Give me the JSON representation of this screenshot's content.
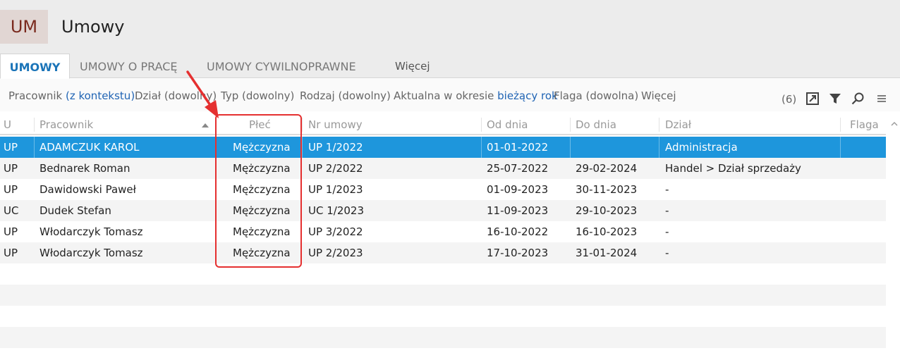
{
  "app": {
    "logo": "UM",
    "title": "Umowy"
  },
  "tabs": [
    {
      "label": "UMOWY",
      "active": true
    },
    {
      "label": "UMOWY O PRACĘ",
      "active": false
    },
    {
      "label": "UMOWY CYWILNOPRAWNE",
      "active": false
    },
    {
      "label": "Więcej",
      "active": false
    }
  ],
  "filters": {
    "pracownik_label": "Pracownik",
    "pracownik_value": "(z kontekstu)",
    "dzial": "Dział (dowolny)",
    "typ": "Typ (dowolny)",
    "rodzaj": "Rodzaj (dowolny)",
    "aktualna_label": "Aktualna w okresie",
    "aktualna_value": "bieżący rok",
    "flaga": "Flaga (dowolna)",
    "wiecej": "Więcej",
    "count": "(6)"
  },
  "toolbar_icons": [
    "export-icon",
    "filter-icon",
    "search-icon",
    "menu-icon"
  ],
  "columns": {
    "u": "U",
    "pracownik": "Pracownik",
    "plec": "Płeć",
    "nr": "Nr umowy",
    "od": "Od dnia",
    "do": "Do dnia",
    "dzial": "Dział",
    "flaga": "Flaga"
  },
  "rows": [
    {
      "u": "UP",
      "pracownik": "ADAMCZUK KAROL",
      "plec": "Mężczyzna",
      "nr": "UP 1/2022",
      "od": "01-01-2022",
      "do": "",
      "dzial": "Administracja",
      "selected": true
    },
    {
      "u": "UP",
      "pracownik": "Bednarek Roman",
      "plec": "Mężczyzna",
      "nr": "UP 2/2022",
      "od": "25-07-2022",
      "do": "29-02-2024",
      "dzial": "Handel > Dział sprzedaży"
    },
    {
      "u": "UP",
      "pracownik": "Dawidowski Paweł",
      "plec": "Mężczyzna",
      "nr": "UP 1/2023",
      "od": "01-09-2023",
      "do": "30-11-2023",
      "dzial": "-"
    },
    {
      "u": "UC",
      "pracownik": "Dudek Stefan",
      "plec": "Mężczyzna",
      "nr": "UC 1/2023",
      "od": "11-09-2023",
      "do": "29-10-2023",
      "dzial": "-"
    },
    {
      "u": "UP",
      "pracownik": "Włodarczyk Tomasz",
      "plec": "Mężczyzna",
      "nr": "UP 3/2022",
      "od": "16-10-2022",
      "do": "16-10-2023",
      "dzial": "-"
    },
    {
      "u": "UP",
      "pracownik": "Włodarczyk Tomasz",
      "plec": "Mężczyzna",
      "nr": "UP 2/2023",
      "od": "17-10-2023",
      "do": "31-01-2024",
      "dzial": "-"
    }
  ],
  "colors": {
    "selection": "#1e96dc",
    "accent_tab": "#1a74b8",
    "link": "#2064b4",
    "annotation": "#e53030",
    "logo_text": "#7a2a1e"
  }
}
